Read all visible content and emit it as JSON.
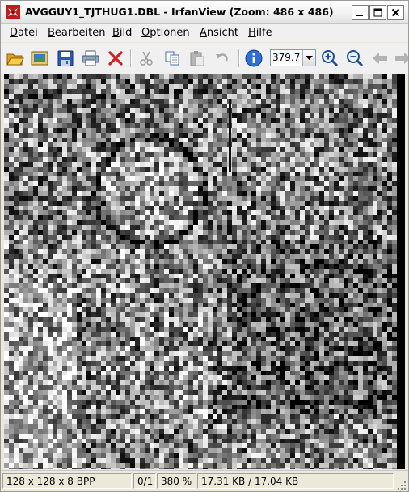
{
  "window": {
    "title": "AVGGUY1_TJTHUG1.DBL - IrfanView (Zoom: 486 x 486)"
  },
  "menu": {
    "items": [
      {
        "first": "D",
        "rest": "atei"
      },
      {
        "first": "B",
        "rest": "earbeiten"
      },
      {
        "first": "B",
        "rest": "ild"
      },
      {
        "first": "O",
        "rest": "ptionen"
      },
      {
        "first": "A",
        "rest": "nsicht"
      },
      {
        "first": "H",
        "rest": "ilfe"
      }
    ]
  },
  "toolbar": {
    "icons": [
      "open-folder-icon",
      "thumbnails-icon",
      "save-icon",
      "print-icon",
      "delete-icon",
      "cut-icon",
      "copy-icon",
      "paste-icon",
      "undo-icon",
      "info-icon",
      "zoom-in-icon",
      "zoom-out-icon",
      "previous-icon",
      "next-icon"
    ],
    "zoom_value": "379.7"
  },
  "statusbar": {
    "dimensions": "128 x 128 x 8 BPP",
    "page": "0/1",
    "zoom_percent": "380 %",
    "file_size": "17.31 KB / 17.04 KB"
  }
}
